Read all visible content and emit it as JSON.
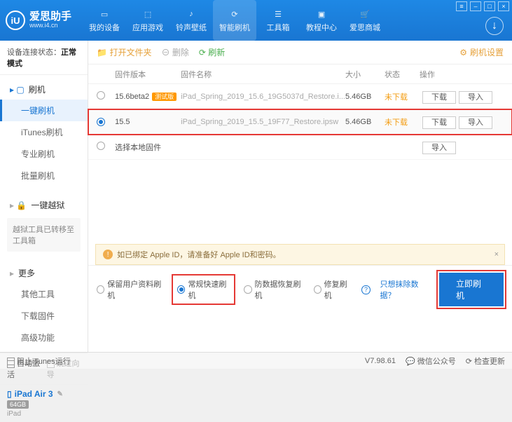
{
  "app": {
    "logo": "iU",
    "name": "爱思助手",
    "url": "www.i4.cn"
  },
  "nav": {
    "items": [
      {
        "id": "device",
        "label": "我的设备"
      },
      {
        "id": "apps",
        "label": "应用游戏"
      },
      {
        "id": "ringtone",
        "label": "铃声壁纸"
      },
      {
        "id": "flash",
        "label": "智能刷机",
        "active": true
      },
      {
        "id": "tools",
        "label": "工具箱"
      },
      {
        "id": "tutorial",
        "label": "教程中心"
      },
      {
        "id": "store",
        "label": "爱思商城"
      }
    ]
  },
  "sidebar": {
    "conn_label": "设备连接状态：",
    "conn_value": "正常模式",
    "flash_head": "刷机",
    "flash_items": [
      "一键刷机",
      "iTunes刷机",
      "专业刷机",
      "批量刷机"
    ],
    "jailbreak_head": "一键越狱",
    "jailbreak_note": "越狱工具已转移至工具箱",
    "more_head": "更多",
    "more_items": [
      "其他工具",
      "下载固件",
      "高级功能"
    ],
    "auto_activate": "自动激活",
    "skip_guide": "跳过向导",
    "device_name": "iPad Air 3",
    "device_storage": "64GB",
    "device_type": "iPad"
  },
  "toolbar": {
    "open_folder": "打开文件夹",
    "delete": "删除",
    "refresh": "刷新",
    "settings": "刷机设置"
  },
  "table": {
    "headers": {
      "version": "固件版本",
      "name": "固件名称",
      "size": "大小",
      "status": "状态",
      "ops": "操作"
    },
    "rows": [
      {
        "version": "15.6beta2",
        "beta": "测试版",
        "name": "iPad_Spring_2019_15.6_19G5037d_Restore.i...",
        "size": "5.46GB",
        "status": "未下载",
        "download": "下载",
        "import": "导入",
        "selected": false
      },
      {
        "version": "15.5",
        "name": "iPad_Spring_2019_15.5_19F77_Restore.ipsw",
        "size": "5.46GB",
        "status": "未下载",
        "download": "下载",
        "import": "导入",
        "selected": true
      }
    ],
    "local_fw": "选择本地固件",
    "local_import": "导入"
  },
  "warning": {
    "icon": "!",
    "text": "如已绑定 Apple ID，请准备好 Apple ID和密码。"
  },
  "flash_options": {
    "opts": [
      "保留用户资料刷机",
      "常规快速刷机",
      "防数据恢复刷机",
      "修复刷机"
    ],
    "selected": 1,
    "help": "?",
    "exclude_link": "只想抹除数据？",
    "go": "立即刷机"
  },
  "statusbar": {
    "block_itunes": "阻止iTunes运行",
    "version": "V7.98.61",
    "wechat": "微信公众号",
    "check_update": "检查更新"
  }
}
